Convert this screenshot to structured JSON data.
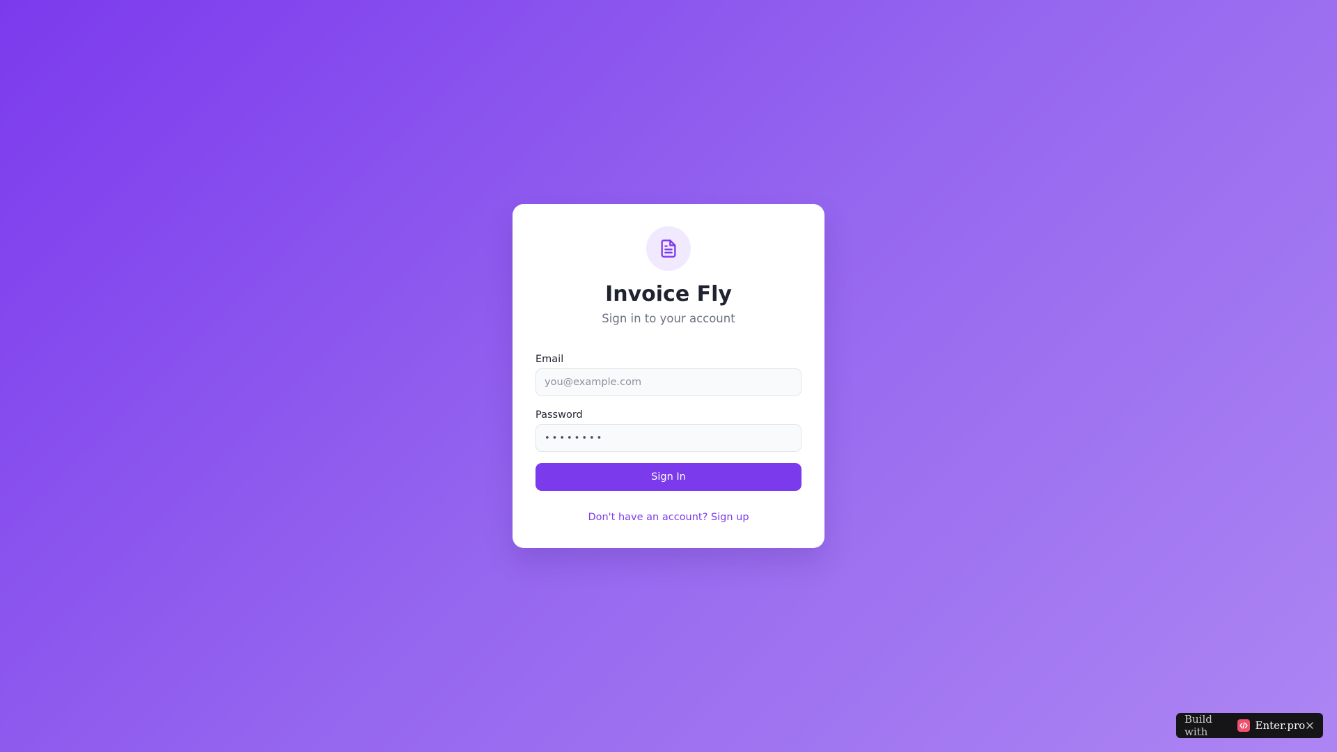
{
  "app": {
    "title": "Invoice Fly",
    "subtitle": "Sign in to your account",
    "logo_icon": "document-icon"
  },
  "form": {
    "email": {
      "label": "Email",
      "value": "",
      "placeholder": "you@example.com"
    },
    "password": {
      "label": "Password",
      "masked_value": "••••••••"
    },
    "submit_label": "Sign In",
    "signup_link": "Don't have an account? Sign up"
  },
  "badge": {
    "prefix": "Build with",
    "brand": "Enter.pro",
    "logo_icon": "code-icon",
    "close_icon": "close-icon"
  },
  "colors": {
    "accent": "#7c3aed",
    "icon_bg": "#f1e9fd",
    "badge_bg": "#151517",
    "badge_logo": "#f0506e"
  }
}
